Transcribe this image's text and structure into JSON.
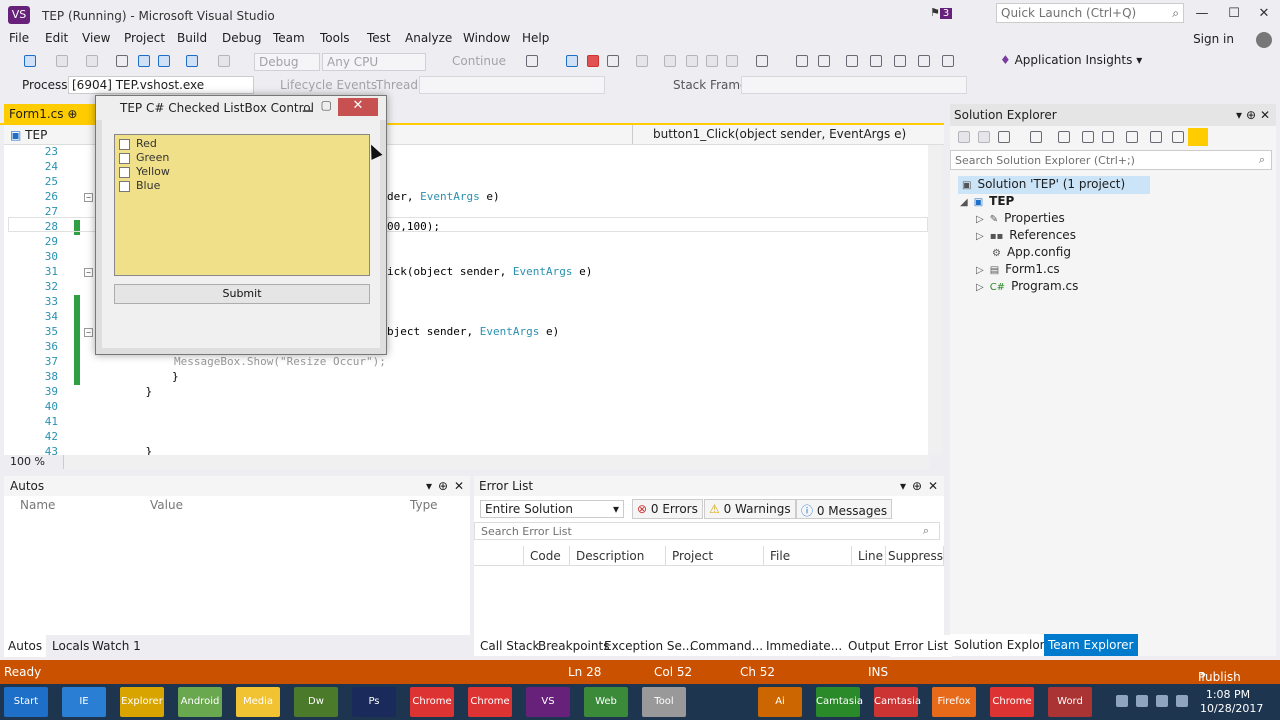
{
  "window": {
    "title": "TEP (Running) - Microsoft Visual Studio",
    "notifications": "3"
  },
  "quick_launch": {
    "placeholder": "Quick Launch (Ctrl+Q)"
  },
  "menu": [
    "File",
    "Edit",
    "View",
    "Project",
    "Build",
    "Debug",
    "Team",
    "Tools",
    "Test",
    "Analyze",
    "Window",
    "Help"
  ],
  "signin": "Sign in",
  "toolbar": {
    "config": "Debug",
    "platform": "Any CPU",
    "continue": "Continue",
    "app_insights": "Application Insights"
  },
  "debug_location": {
    "process_label": "Process:",
    "process": "[6904] TEP.vshost.exe",
    "lifecycle": "Lifecycle Events",
    "thread_label": "Thread:",
    "stack_label": "Stack Frame:"
  },
  "editor": {
    "tab": "Form1.cs",
    "nav_left": "TEP",
    "nav_right": "button1_Click(object sender, EventArgs e)",
    "zoom": "100 %",
    "lines": [
      {
        "n": "23",
        "code": ""
      },
      {
        "n": "24",
        "code": ""
      },
      {
        "n": "25",
        "code": ""
      },
      {
        "n": "26",
        "code": "der, ",
        "type": "EventArgs",
        "rest": " e)"
      },
      {
        "n": "27",
        "code": ""
      },
      {
        "n": "28",
        "code": "00,100);"
      },
      {
        "n": "29",
        "code": ""
      },
      {
        "n": "30",
        "code": ""
      },
      {
        "n": "31",
        "code": "ick(object sender, ",
        "type": "EventArgs",
        "rest": " e)"
      },
      {
        "n": "32",
        "code": ""
      },
      {
        "n": "33",
        "code": ""
      },
      {
        "n": "34",
        "code": ""
      },
      {
        "n": "35",
        "code": "bject sender, ",
        "type": "EventArgs",
        "rest": " e)"
      },
      {
        "n": "36",
        "code": ""
      },
      {
        "n": "37",
        "code": "MessageBox.Show(\"Resize Occur\");"
      },
      {
        "n": "38",
        "code": "        }"
      },
      {
        "n": "39",
        "code": "    }"
      },
      {
        "n": "40",
        "code": ""
      },
      {
        "n": "41",
        "code": ""
      },
      {
        "n": "42",
        "code": ""
      },
      {
        "n": "43",
        "code": "    }"
      }
    ]
  },
  "form": {
    "title": "TEP C# Checked ListBox Control",
    "items": [
      "Red",
      "Green",
      "Yellow",
      "Blue"
    ],
    "submit": "Submit"
  },
  "solution_explorer": {
    "title": "Solution Explorer",
    "search": "Search Solution Explorer (Ctrl+;)",
    "solution": "Solution 'TEP' (1 project)",
    "project": "TEP",
    "items": [
      "Properties",
      "References",
      "App.config",
      "Form1.cs",
      "Program.cs"
    ],
    "tabs": [
      "Solution Explorer",
      "Team Explorer"
    ]
  },
  "autos": {
    "title": "Autos",
    "columns": [
      "Name",
      "Value",
      "Type"
    ],
    "tabs": [
      "Autos",
      "Locals",
      "Watch 1"
    ]
  },
  "error_list": {
    "title": "Error List",
    "scope": "Entire Solution",
    "errors": "0 Errors",
    "warnings": "0 Warnings",
    "messages": "0 Messages",
    "search": "Search Error List",
    "columns": [
      "Code",
      "Description",
      "Project",
      "File",
      "Line",
      "Suppressio"
    ]
  },
  "bottom_tabs": [
    "Call Stack",
    "Breakpoints",
    "Exception Se...",
    "Command...",
    "Immediate...",
    "Output",
    "Error List"
  ],
  "status": {
    "ready": "Ready",
    "ln": "Ln 28",
    "col": "Col 52",
    "ch": "Ch 52",
    "ins": "INS",
    "publish": "Publish"
  },
  "taskbar": {
    "time": "1:08 PM",
    "date": "10/28/2017",
    "apps": [
      "Start",
      "IE",
      "Explorer",
      "Android",
      "Media",
      "Dw",
      "Ps",
      "Chrome",
      "Chrome",
      "VS",
      "Web",
      "Tool",
      "Ai",
      "Camtasia",
      "Camtasia",
      "Firefox",
      "Chrome",
      "Word"
    ]
  },
  "colors": {
    "accent": "#68217a",
    "status_bar": "#ca5100",
    "doc_tab": "#ffcc00",
    "listbox": "#f0e08a"
  }
}
